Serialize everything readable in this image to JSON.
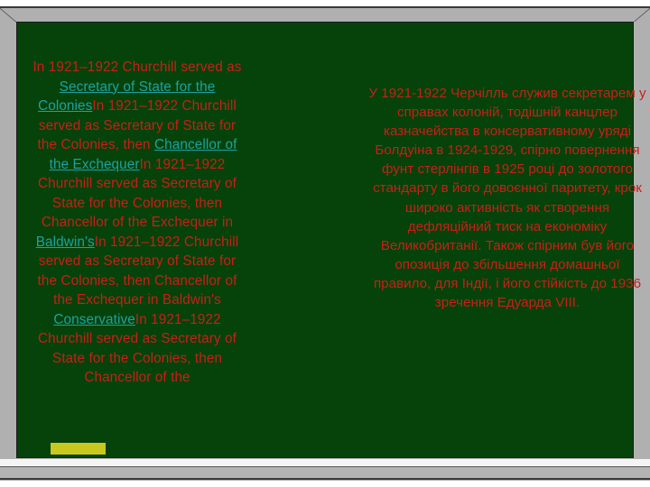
{
  "slide": {
    "left_column": [
      {
        "type": "text",
        "value": "In 1921–1922 Churchill served as "
      },
      {
        "type": "link",
        "value": "Secretary of State for the Colonies"
      },
      {
        "type": "text",
        "value": "In 1921–1922 Churchill served as Secretary of State for the Colonies, then "
      },
      {
        "type": "link",
        "value": "Chancellor of the Exchequer"
      },
      {
        "type": "text",
        "value": "In 1921–1922 Churchill served as Secretary of State for the Colonies, then Chancellor of the Exchequer in "
      },
      {
        "type": "link",
        "value": "Baldwin's"
      },
      {
        "type": "text",
        "value": "In 1921–1922 Churchill served as Secretary of State for the Colonies, then Chancellor of the Exchequer in Baldwin's "
      },
      {
        "type": "link",
        "value": "Conservative"
      },
      {
        "type": "text",
        "value": "In 1921–1922 Churchill served as Secretary of State for the Colonies, then Chancellor of the"
      }
    ],
    "right_column": "У 1921-1922 Черчілль служив секретарем у справах колоній, тодішній канцлер казначейства в консервативному уряді Болдуіна в 1924-1929, спірно повернення фунт стерлінгів в 1925 році до золотого стандарту в його довоєнної паритету, крок широко активність як створення дефляційний тиск на економіку Великобританії. Також спірним був його опозиція до збільшення домашньої правило, для Індії, і його стійкість до 1936 зречення Едуарда VIII."
  },
  "colors": {
    "board": "#05430a",
    "text": "#cc1d18",
    "link": "#1fa0a0",
    "frame": "#b0b0b0",
    "chalk": "#c8c81e"
  }
}
